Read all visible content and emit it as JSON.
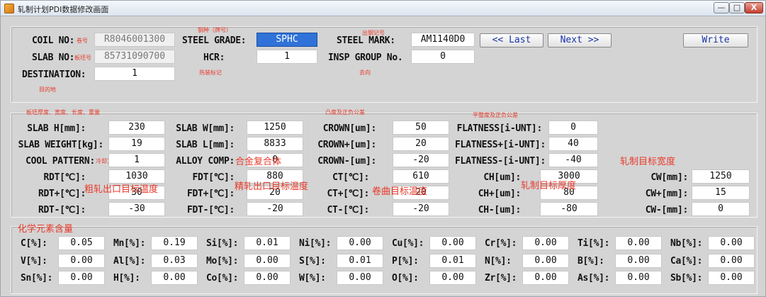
{
  "window": {
    "title": "轧制计划PDI数据修改画面",
    "minimize_label": "—",
    "maximize_label": "□",
    "close_label": "X"
  },
  "top": {
    "coil_no": {
      "label": "COIL NO:",
      "value": "R8046001300",
      "annotation": "卷号"
    },
    "slab_no": {
      "label": "SLAB NO:",
      "value": "85731090700",
      "annotation": "板坯号"
    },
    "destination": {
      "label": "DESTINATION:",
      "value": "1",
      "annotation": "目的地"
    },
    "steel_grade": {
      "label": "STEEL GRADE:",
      "value": "SPHC",
      "annotation": "钢种（牌号）"
    },
    "hcr": {
      "label": "HCR:",
      "value": "1",
      "annotation": "热装标记"
    },
    "steel_mark": {
      "label": "STEEL MARK:",
      "value": "AM1140D0",
      "annotation": "出钢记号"
    },
    "insp_group": {
      "label": "INSP GROUP No.",
      "value": "0",
      "annotation": "去向"
    },
    "last_button": "<< Last",
    "next_button": "Next >>",
    "write_button": "Write"
  },
  "params": {
    "annotations": {
      "slab_dims": "板坯厚度、宽度、长度、重量",
      "crown": "凸度及正负公差",
      "flatness": "平整度及正负公差",
      "cool_pattern": "冷却方式",
      "alloy": "合金复合体",
      "rdt": "粗轧出口目标温度",
      "fdt": "精轧出口目标温度",
      "ct": "卷曲目标温度",
      "ch": "轧制目标厚度",
      "cw": "轧制目标宽度"
    },
    "slab_h": {
      "label": "SLAB H[mm]:",
      "value": "230"
    },
    "slab_weight": {
      "label": "SLAB WEIGHT[kg]:",
      "value": "19"
    },
    "cool_pattern": {
      "label": "COOL PATTERN:",
      "value": "1"
    },
    "rdt": {
      "label": "RDT[℃]:",
      "value": "1030"
    },
    "rdt_plus": {
      "label": "RDT+[℃]:",
      "value": "30"
    },
    "rdt_minus": {
      "label": "RDT-[℃]:",
      "value": "-30"
    },
    "slab_w": {
      "label": "SLAB W[mm]:",
      "value": "1250"
    },
    "slab_l": {
      "label": "SLAB L[mm]:",
      "value": "8833"
    },
    "alloy_comp": {
      "label": "ALLOY COMP:",
      "value": "0"
    },
    "fdt": {
      "label": "FDT[℃]:",
      "value": "880"
    },
    "fdt_plus": {
      "label": "FDT+[℃]:",
      "value": "20"
    },
    "fdt_minus": {
      "label": "FDT-[℃]:",
      "value": "-20"
    },
    "crown": {
      "label": "CROWN[um]:",
      "value": "50"
    },
    "crown_plus": {
      "label": "CROWN+[um]:",
      "value": "20"
    },
    "crown_minus": {
      "label": "CROWN-[um]:",
      "value": "-20"
    },
    "ct": {
      "label": "CT[℃]:",
      "value": "610"
    },
    "ct_plus": {
      "label": "CT+[℃]:",
      "value": "20"
    },
    "ct_minus": {
      "label": "CT-[℃]:",
      "value": "-20"
    },
    "flatness": {
      "label": "FLATNESS[i-UNT]:",
      "value": "0"
    },
    "flatness_plus": {
      "label": "FLATNESS+[i-UNT]:",
      "value": "40"
    },
    "flatness_minus": {
      "label": "FLATNESS-[i-UNT]:",
      "value": "-40"
    },
    "ch": {
      "label": "CH[um]:",
      "value": "3000"
    },
    "ch_plus": {
      "label": "CH+[um]:",
      "value": "80"
    },
    "ch_minus": {
      "label": "CH-[um]:",
      "value": "-80"
    },
    "cw": {
      "label": "CW[mm]:",
      "value": "1250"
    },
    "cw_plus": {
      "label": "CW+[mm]:",
      "value": "15"
    },
    "cw_minus": {
      "label": "CW-[mm]:",
      "value": "0"
    }
  },
  "chemistry": {
    "annotation": "化学元素含量",
    "rows": [
      [
        {
          "label": "C[%]:",
          "value": "0.05"
        },
        {
          "label": "Mn[%]:",
          "value": "0.19"
        },
        {
          "label": "Si[%]:",
          "value": "0.01"
        },
        {
          "label": "Ni[%]:",
          "value": "0.00"
        },
        {
          "label": "Cu[%]:",
          "value": "0.00"
        },
        {
          "label": "Cr[%]:",
          "value": "0.00"
        },
        {
          "label": "Ti[%]:",
          "value": "0.00"
        },
        {
          "label": "Nb[%]:",
          "value": "0.00"
        }
      ],
      [
        {
          "label": "V[%]:",
          "value": "0.00"
        },
        {
          "label": "Al[%]:",
          "value": "0.03"
        },
        {
          "label": "Mo[%]:",
          "value": "0.00"
        },
        {
          "label": "S[%]:",
          "value": "0.01"
        },
        {
          "label": "P[%]:",
          "value": "0.01"
        },
        {
          "label": "N[%]:",
          "value": "0.00"
        },
        {
          "label": "B[%]:",
          "value": "0.00"
        },
        {
          "label": "Ca[%]:",
          "value": "0.00"
        }
      ],
      [
        {
          "label": "Sn[%]:",
          "value": "0.00"
        },
        {
          "label": "H[%]:",
          "value": "0.00"
        },
        {
          "label": "Co[%]:",
          "value": "0.00"
        },
        {
          "label": "W[%]:",
          "value": "0.00"
        },
        {
          "label": "O[%]:",
          "value": "0.00"
        },
        {
          "label": "Zr[%]:",
          "value": "0.00"
        },
        {
          "label": "As[%]:",
          "value": "0.00"
        },
        {
          "label": "Sb[%]:",
          "value": "0.00"
        }
      ]
    ]
  }
}
